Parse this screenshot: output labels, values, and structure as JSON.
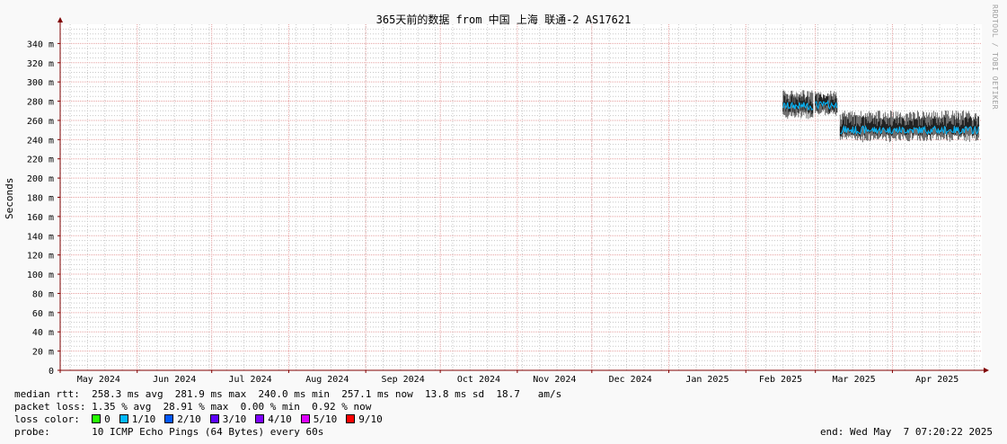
{
  "chart_data": {
    "type": "area",
    "title": "365天前的数据 from 中国 上海 联通-2 AS17621",
    "ylabel": "Seconds",
    "ylim": [
      0,
      360
    ],
    "y_ticks": [
      0,
      20,
      40,
      60,
      80,
      100,
      120,
      140,
      160,
      180,
      200,
      220,
      240,
      260,
      280,
      300,
      320,
      340
    ],
    "y_tick_labels": [
      "0",
      "20 m",
      "40 m",
      "60 m",
      "80 m",
      "100 m",
      "120 m",
      "140 m",
      "160 m",
      "180 m",
      "200 m",
      "220 m",
      "240 m",
      "260 m",
      "280 m",
      "300 m",
      "320 m",
      "340 m"
    ],
    "x_range": [
      "2024-05-01",
      "2025-05-07"
    ],
    "x_ticks": [
      "May 2024",
      "Jun 2024",
      "Jul 2024",
      "Aug 2024",
      "Sep 2024",
      "Oct 2024",
      "Nov 2024",
      "Dec 2024",
      "Jan 2025",
      "Feb 2025",
      "Mar 2025",
      "Apr 2025"
    ],
    "grid": true,
    "series": [
      {
        "name": "median rtt",
        "segments": [
          {
            "start": "2025-02-16",
            "end": "2025-02-28",
            "median": 275,
            "min": 262,
            "max": 292
          },
          {
            "start": "2025-03-01",
            "end": "2025-03-10",
            "median": 276,
            "min": 265,
            "max": 290
          },
          {
            "start": "2025-03-11",
            "end": "2025-05-06",
            "median": 250,
            "min": 238,
            "max": 270
          }
        ]
      }
    ]
  },
  "watermark": "RRDTOOL / TOBI OETIKER",
  "stats": {
    "rtt_line": "median rtt:  258.3 ms avg  281.9 ms max  240.0 ms min  257.1 ms now  13.8 ms sd  18.7   am/s",
    "loss_line": "packet loss: 1.35 % avg  28.91 % max  0.00 % min  0.92 % now",
    "loss_color_label": "loss color:",
    "probe_line": "probe:       10 ICMP Echo Pings (64 Bytes) every 60s",
    "end_line": "end: Wed May  7 07:20:22 2025"
  },
  "loss_colors": [
    {
      "label": "0",
      "color": "#26ff00"
    },
    {
      "label": "1/10",
      "color": "#00b8ff"
    },
    {
      "label": "2/10",
      "color": "#0059ff"
    },
    {
      "label": "3/10",
      "color": "#5e00ff"
    },
    {
      "label": "4/10",
      "color": "#7e00ff"
    },
    {
      "label": "5/10",
      "color": "#dd00ff"
    },
    {
      "label": "9/10",
      "color": "#ff0000"
    }
  ],
  "colors": {
    "axis": "#800000",
    "minor_grid": "#c8c8c8",
    "major_grid": "#e6a0a0",
    "smoke": "#707070",
    "median": "#00b8ff"
  }
}
